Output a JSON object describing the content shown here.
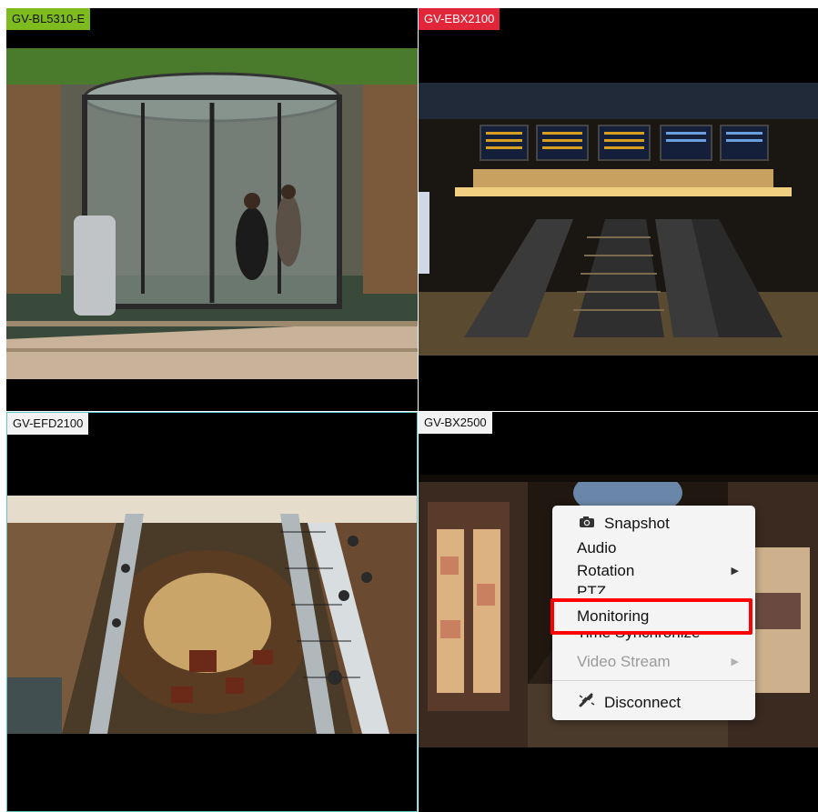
{
  "cameras": [
    {
      "label": "GV-BL5310-E",
      "label_bg": "#7dbb1e",
      "scene": "revolving glass door entrance"
    },
    {
      "label": "GV-EBX2100",
      "label_bg": "#e02638",
      "scene": "escalators under departure boards"
    },
    {
      "label": "GV-EFD2100",
      "label_bg": "#f2f2f2",
      "scene": "shopping mall atrium from above"
    },
    {
      "label": "GV-BX2500",
      "label_bg": "#f2f2f2",
      "scene": "shopping arcade at night"
    }
  ],
  "context_menu": {
    "items": [
      {
        "label": "Snapshot",
        "icon": "camera-icon",
        "enabled": true
      },
      {
        "label": "Audio",
        "enabled": true
      },
      {
        "label": "Rotation",
        "enabled": true,
        "submenu": true
      },
      {
        "label": "PTZ",
        "enabled": true
      },
      {
        "label": "Monitoring",
        "enabled": true,
        "highlighted": true
      },
      {
        "label": "Time Synchronize",
        "enabled": true
      },
      {
        "label": "Video Stream",
        "enabled": false,
        "submenu": true
      },
      {
        "label": "Disconnect",
        "icon": "disconnect-icon",
        "enabled": true
      }
    ],
    "submenu_arrow": "▶"
  },
  "colors": {
    "selected_tile_border": "#5ec6c6",
    "highlight_box": "#ff0000"
  }
}
